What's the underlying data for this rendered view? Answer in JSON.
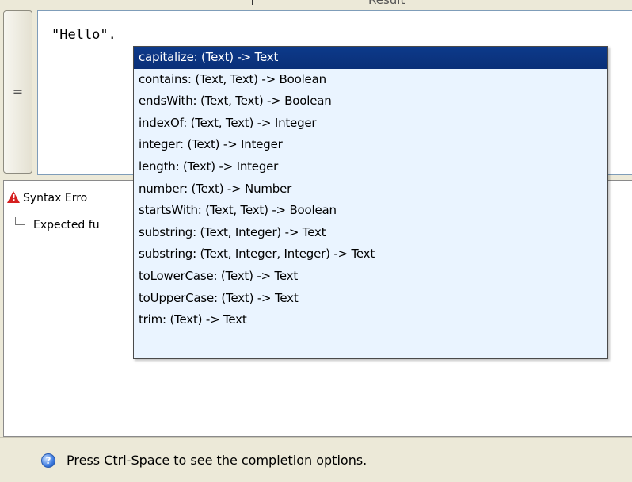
{
  "top_strip": {
    "partial_label": "Result"
  },
  "equals_button": {
    "glyph": "="
  },
  "editor": {
    "code": "\"Hello\"."
  },
  "messages": {
    "error_text": "Syntax Erro",
    "error_icon": "warning-icon",
    "detail_text": "Expected fu"
  },
  "completion": {
    "selected_index": 0,
    "items": [
      "capitalize: (Text) -> Text",
      "contains: (Text, Text) -> Boolean",
      "endsWith: (Text, Text) -> Boolean",
      "indexOf: (Text, Text) -> Integer",
      "integer: (Text) -> Integer",
      "length: (Text) -> Integer",
      "number: (Text) -> Number",
      "startsWith: (Text, Text) -> Boolean",
      "substring: (Text, Integer) -> Text",
      "substring: (Text, Integer, Integer) -> Text",
      "toLowerCase: (Text) -> Text",
      "toUpperCase: (Text) -> Text",
      "trim: (Text) -> Text"
    ],
    "colors": {
      "background": "#eaf4ff",
      "selected_background": "#0a2f78",
      "selected_text": "#ffffff"
    }
  },
  "status_bar": {
    "icon": "info-icon",
    "text": "Press Ctrl-Space to see the completion options."
  }
}
